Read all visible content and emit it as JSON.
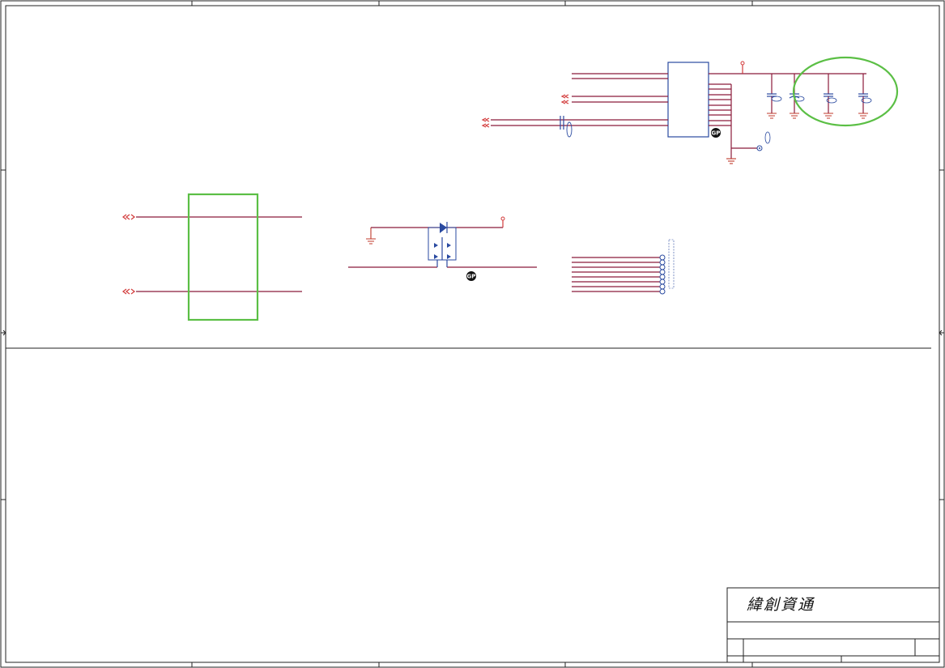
{
  "title_block": {
    "company": "緯創資通"
  },
  "markers": {
    "gp_label": "GP"
  },
  "colors": {
    "wire": "#8b1a3a",
    "power": "#d23a3a",
    "component": "#2a4aa0",
    "highlight": "#5bbf45",
    "border": "#222222"
  },
  "icons": {
    "ground": "ground-symbol",
    "capacitor": "capacitor-symbol",
    "diode": "diode-symbol",
    "test_point": "test-point-symbol",
    "off_page_connector": "off-page-connector-symbol"
  }
}
